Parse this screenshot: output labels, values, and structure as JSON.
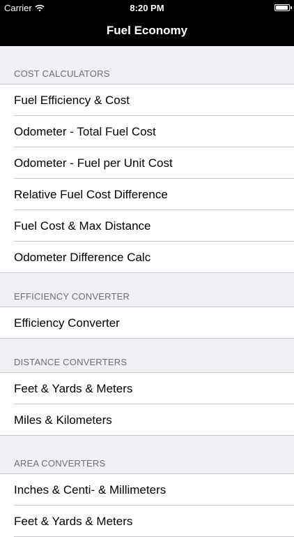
{
  "status_bar": {
    "carrier": "Carrier",
    "time": "8:20 PM",
    "battery_level": 0.95
  },
  "nav": {
    "title": "Fuel Economy"
  },
  "sections": [
    {
      "header": "COST CALCULATORS",
      "items": [
        {
          "label": "Fuel Efficiency & Cost"
        },
        {
          "label": "Odometer - Total Fuel Cost"
        },
        {
          "label": "Odometer - Fuel per Unit Cost"
        },
        {
          "label": "Relative Fuel Cost Difference"
        },
        {
          "label": "Fuel Cost & Max Distance"
        },
        {
          "label": "Odometer Difference Calc"
        }
      ]
    },
    {
      "header": "EFFICIENCY CONVERTER",
      "items": [
        {
          "label": "Efficiency Converter"
        }
      ]
    },
    {
      "header": "DISTANCE CONVERTERS",
      "items": [
        {
          "label": "Feet & Yards & Meters"
        },
        {
          "label": "Miles & Kilometers"
        }
      ]
    },
    {
      "header": "AREA CONVERTERS",
      "items": [
        {
          "label": "Inches & Centi- & Millimeters"
        },
        {
          "label": "Feet & Yards & Meters"
        }
      ]
    }
  ]
}
